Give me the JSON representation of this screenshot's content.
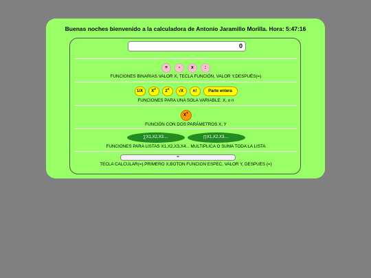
{
  "greeting": "Buenas noches bienvenido a la calculadora de Antonio Jaramillo Morilla. Hora: 5:47:16",
  "display": {
    "value": "0"
  },
  "binary": {
    "buttons": [
      "+",
      "-",
      "x",
      ":"
    ],
    "caption": "FUNCIONES BINARIAS.VALOR X, TECLA FUNCIÓN, VALOR Y,DESPUÉS(=)"
  },
  "single": {
    "buttons": {
      "inverse": "1/X",
      "square_base": "X",
      "square_exp": "2",
      "pow2_base": "2",
      "pow2_exp": "X",
      "sqrt": "√X",
      "factorial": "n!",
      "integer": "Parte entera"
    },
    "caption": "FUNCIONES PARA UNA SOLA VARIABLE: X, o n"
  },
  "two_param": {
    "button_base": "X",
    "button_exp": "Y",
    "caption": "FUNCIÓN CON DOS PARÁMETROS X, Y"
  },
  "lists": {
    "sum_button": "∑X1,X2,X3....",
    "product_button": "∏X1,X2,X3....",
    "caption": "FUNCIONES PARA LISTAS X1,X2,X3,X4... MULTIPLICA O SUMA TODA LA LISTA"
  },
  "calculate": {
    "button": "=",
    "caption": "TECLA CALCULAR(=).PRIMERO X,BOTON FUNCION ESPEC, VALOR Y, DESPUES (=)"
  },
  "colors": {
    "background": "#808080",
    "panel": "#99ff66",
    "pink": "#ffc0cb",
    "yellow": "#ffff00",
    "orange": "#ff9900",
    "green": "#228b22"
  }
}
